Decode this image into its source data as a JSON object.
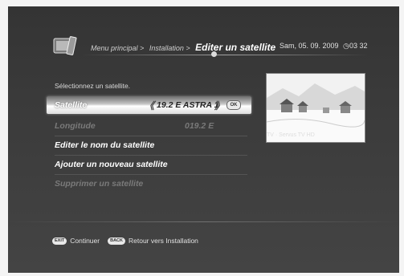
{
  "header": {
    "crumbs": [
      "Menu principal >",
      "Installation >"
    ],
    "current": "Editer un satellite",
    "date": "Sam, 05. 09. 2009",
    "time": "03 32"
  },
  "instruction": "Sélectionnez un satellite.",
  "menu": {
    "satellite": {
      "label": "Satellite",
      "value": "19.2 E ASTRA 1",
      "ok": "OK"
    },
    "longitude": {
      "label": "Longitude",
      "value": "019.2 E"
    },
    "edit_name": "Editer le nom du satellite",
    "add_new": "Ajouter un nouveau satellite",
    "delete": "Supprimer un satellite"
  },
  "preview": {
    "caption": "TV · Servus TV HD"
  },
  "footer": {
    "exit_key": "EXIT",
    "exit_label": "Continuer",
    "back_key": "BACK",
    "back_label": "Retour vers Installation"
  },
  "icons": {
    "menu": "tv-menu-icon",
    "clock": "clock-icon",
    "left": "chevron-left-icon",
    "right": "chevron-right-icon",
    "ok": "ok-button-icon"
  }
}
